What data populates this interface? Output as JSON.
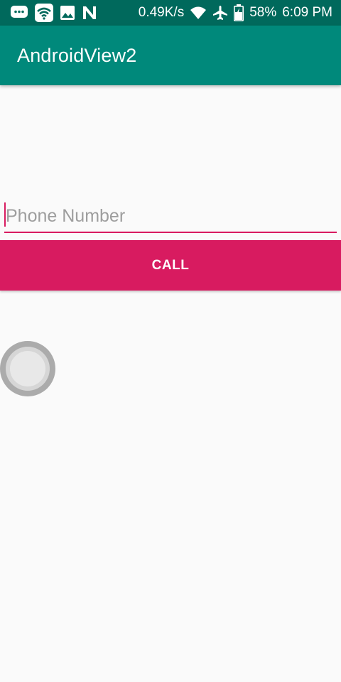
{
  "status_bar": {
    "left_icons": [
      "chat-bubble-icon",
      "wifi-box-icon",
      "image-icon",
      "n-notification-icon"
    ],
    "speed": "0.49K/s",
    "right_icons": [
      "wifi-icon",
      "airplane-icon",
      "battery-icon"
    ],
    "battery": "58%",
    "time": "6:09 PM"
  },
  "app_bar": {
    "title": "AndroidView2"
  },
  "form": {
    "phone_value": "",
    "phone_placeholder": "Phone Number",
    "call_label": "CALL"
  },
  "colors": {
    "status_bar": "#00695c",
    "app_bar": "#00897b",
    "accent": "#d81b60",
    "background": "#fafafa"
  }
}
